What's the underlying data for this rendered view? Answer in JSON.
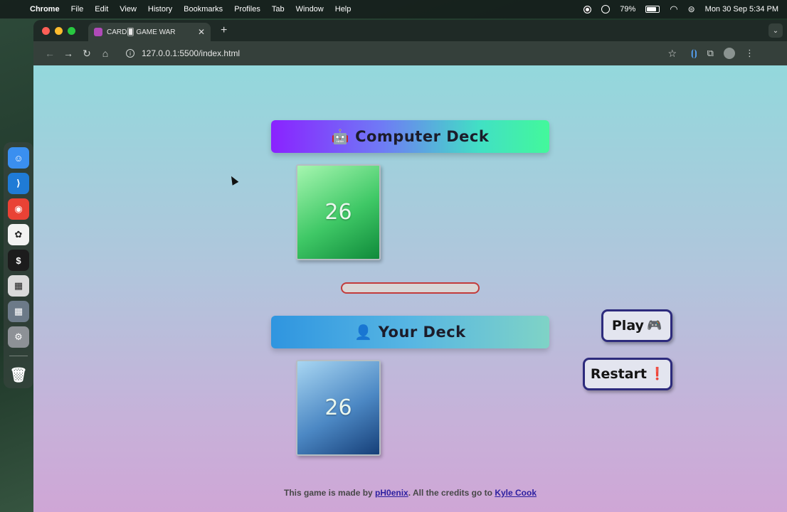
{
  "menubar": {
    "app": "Chrome",
    "items": [
      "File",
      "Edit",
      "View",
      "History",
      "Bookmarks",
      "Profiles",
      "Tab",
      "Window",
      "Help"
    ],
    "battery_percent": "79%",
    "battery_level": 0.79,
    "datetime": "Mon 30 Sep  5:34 PM"
  },
  "dock": {
    "apps": [
      {
        "name": "Finder",
        "color": "#3a8ff0",
        "glyph": "☺"
      },
      {
        "name": "Visual Studio Code",
        "color": "#1f7bd6",
        "glyph": "⟩"
      },
      {
        "name": "Google Chrome",
        "color": "#e94235",
        "glyph": "◉"
      },
      {
        "name": "ChatGPT",
        "color": "#f2f2f2",
        "glyph": "✿"
      },
      {
        "name": "Terminal",
        "color": "#1c1c1c",
        "glyph": "$"
      },
      {
        "name": "Calculator",
        "color": "#dadada",
        "glyph": "▦"
      },
      {
        "name": "Launchpad",
        "color": "#6c7a88",
        "glyph": "▦"
      },
      {
        "name": "System Settings",
        "color": "#8d9196",
        "glyph": "⚙"
      }
    ],
    "trash": {
      "name": "Trash",
      "glyph": "🗑"
    }
  },
  "browser": {
    "tab_title": "CARD🂠 GAME WAR",
    "url": "127.0.0.1:5500/index.html"
  },
  "game": {
    "computer_deck_label": "Computer Deck",
    "computer_deck_emoji": "🤖",
    "computer_card_count": "26",
    "result_text": "",
    "player_deck_label": "Your Deck",
    "player_deck_emoji": "👤",
    "player_card_count": "26",
    "play_label": "Play",
    "play_emoji": "🎮",
    "restart_label": "Restart",
    "restart_emoji": "❗"
  },
  "footer": {
    "prefix": "This game is made by ",
    "author": "pH0enix",
    "middle": ". All the credits go to ",
    "credit": "Kyle Cook"
  }
}
